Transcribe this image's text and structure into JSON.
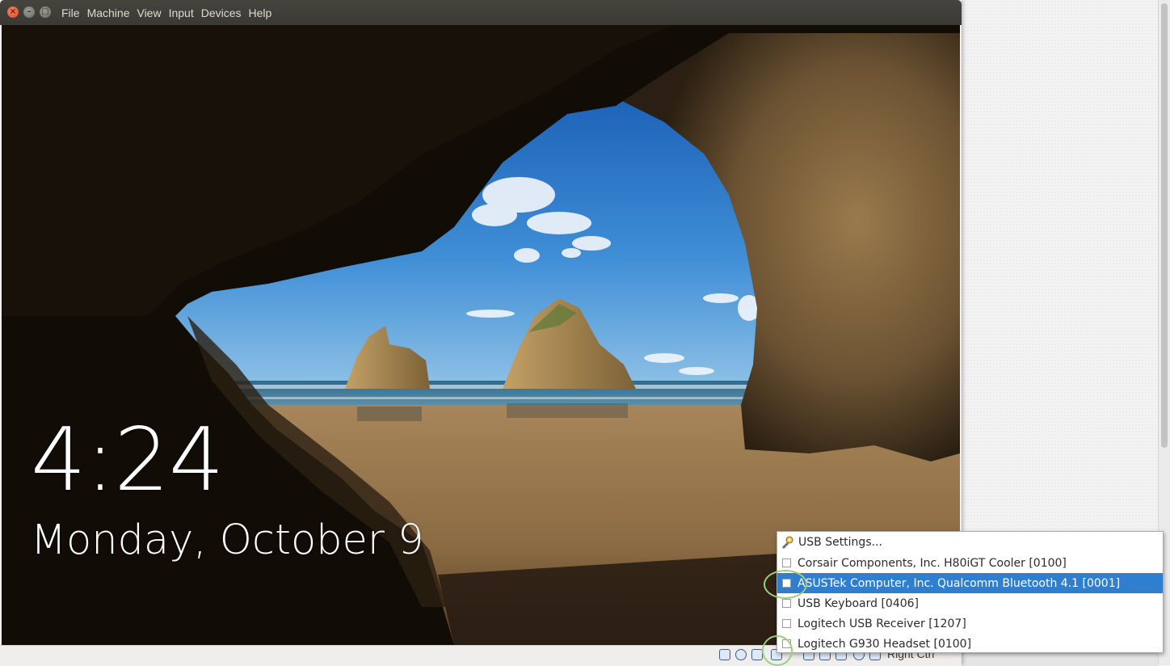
{
  "window": {
    "menu": [
      "File",
      "Machine",
      "View",
      "Input",
      "Devices",
      "Help"
    ]
  },
  "lockscreen": {
    "time": "4:24",
    "date": "Monday, October 9"
  },
  "statusbar": {
    "host_key": "Right Ctrl"
  },
  "usb_menu": {
    "settings_label": "USB Settings...",
    "devices": [
      {
        "label": "Corsair Components, Inc. H80iGT Cooler [0100]",
        "checked": false,
        "highlighted": false
      },
      {
        "label": "ASUSTek Computer, Inc. Qualcomm Bluetooth 4.1 [0001]",
        "checked": false,
        "highlighted": true
      },
      {
        "label": "USB Keyboard [0406]",
        "checked": false,
        "highlighted": false
      },
      {
        "label": "Logitech USB Receiver [1207]",
        "checked": false,
        "highlighted": false
      },
      {
        "label": "Logitech G930 Headset [0100]",
        "checked": false,
        "highlighted": false
      }
    ]
  },
  "colors": {
    "titlebar": "#3c3b37",
    "selection": "#2f7fd1",
    "annotation": "#9ad07c",
    "close_button": "#e95420"
  },
  "icons": {
    "window_close": "close-icon",
    "window_minimize": "minimize-icon",
    "window_maximize": "maximize-icon",
    "usb_settings": "usb-settings-icon"
  }
}
